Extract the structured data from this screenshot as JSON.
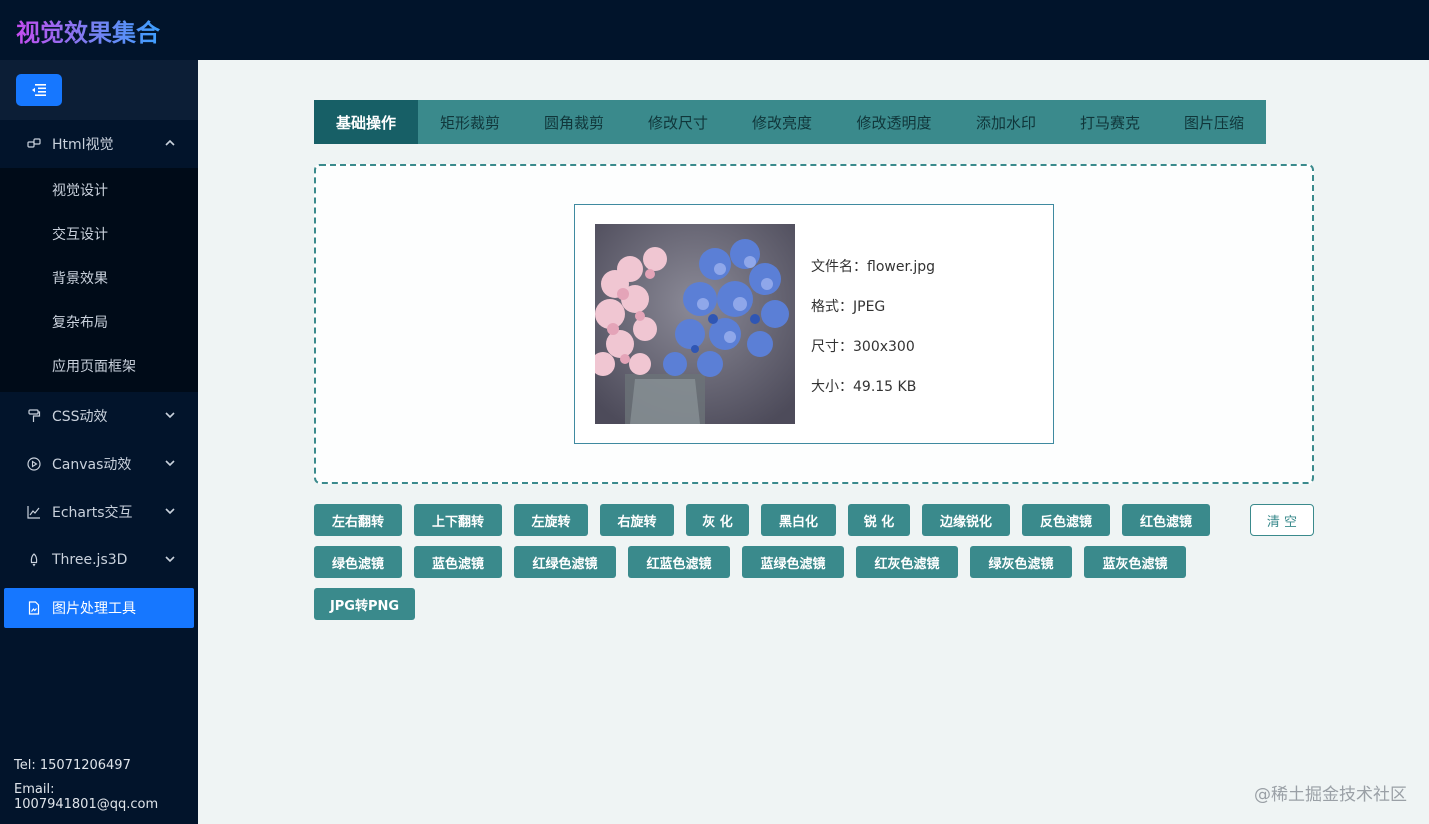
{
  "app": {
    "title": "视觉效果集合"
  },
  "sidebar": {
    "menu": [
      {
        "label": "Html视觉",
        "icon": "link-icon",
        "expanded": true
      },
      {
        "label": "CSS动效",
        "icon": "paint-roller-icon"
      },
      {
        "label": "Canvas动效",
        "icon": "play-circle-icon"
      },
      {
        "label": "Echarts交互",
        "icon": "line-chart-icon"
      },
      {
        "label": "Three.js3D",
        "icon": "rocket-icon"
      },
      {
        "label": "图片处理工具",
        "icon": "file-image-icon",
        "active": true
      }
    ],
    "submenu": [
      "视觉设计",
      "交互设计",
      "背景效果",
      "复杂布局",
      "应用页面框架"
    ],
    "contact": {
      "tel": "Tel: 15071206497",
      "email": "Email: 1007941801@qq.com"
    }
  },
  "tabs": [
    "基础操作",
    "矩形裁剪",
    "圆角裁剪",
    "修改尺寸",
    "修改亮度",
    "修改透明度",
    "添加水印",
    "打马赛克",
    "图片压缩"
  ],
  "file": {
    "name": "文件名：flower.jpg",
    "format": "格式：JPEG",
    "size": "尺寸：300x300",
    "bytes": "大小：49.15 KB"
  },
  "operations": {
    "row1": [
      "左右翻转",
      "上下翻转",
      "左旋转",
      "右旋转",
      "灰 化",
      "黑白化",
      "锐 化",
      "边缘锐化",
      "反色滤镜",
      "红色滤镜"
    ],
    "row2": [
      "绿色滤镜",
      "蓝色滤镜",
      "红绿色滤镜",
      "红蓝色滤镜",
      "蓝绿色滤镜",
      "红灰色滤镜",
      "绿灰色滤镜",
      "蓝灰色滤镜"
    ],
    "row3": [
      "JPG转PNG"
    ],
    "clear": "清 空"
  },
  "watermark": "@稀土掘金技术社区",
  "colors": {
    "accent": "#3a8a8c",
    "active_tab": "#175f66",
    "menu_active": "#1677ff",
    "sidebar": "#02142b"
  }
}
